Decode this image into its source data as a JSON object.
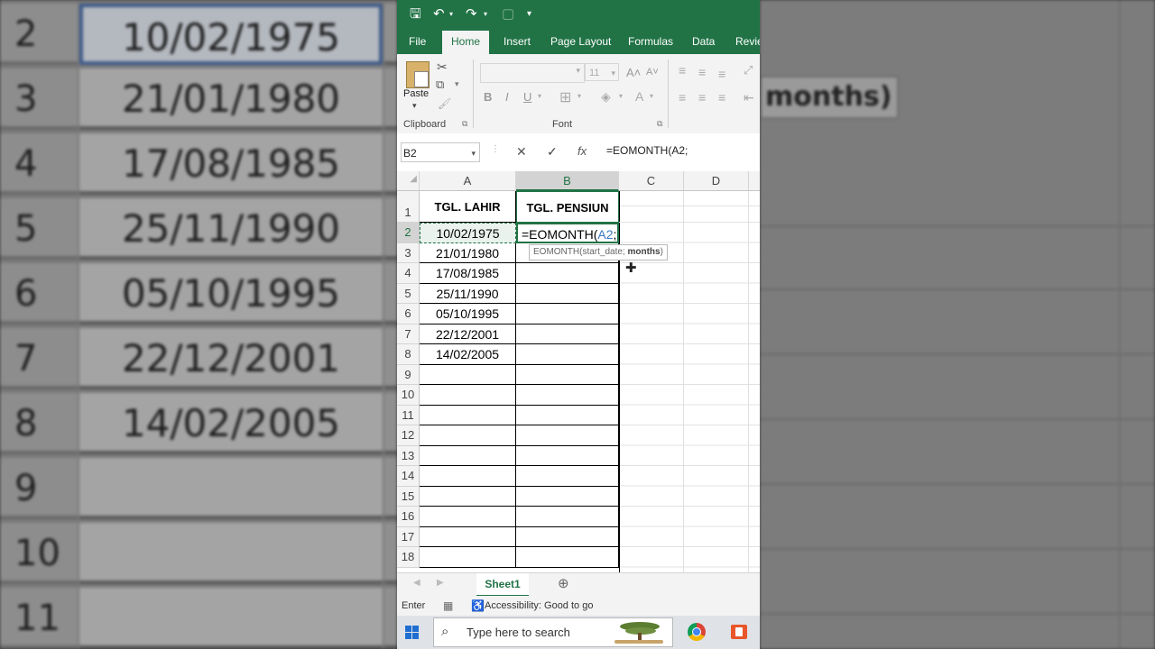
{
  "background": {
    "left_rows": [
      {
        "row": "2",
        "value": "10/02/1975"
      },
      {
        "row": "3",
        "value": "21/01/1980"
      },
      {
        "row": "4",
        "value": "17/08/1985"
      },
      {
        "row": "5",
        "value": "25/11/1990"
      },
      {
        "row": "6",
        "value": "05/10/1995"
      },
      {
        "row": "7",
        "value": "22/12/2001"
      },
      {
        "row": "8",
        "value": "14/02/2005"
      },
      {
        "row": "9",
        "value": ""
      },
      {
        "row": "10",
        "value": ""
      },
      {
        "row": "11",
        "value": ""
      }
    ],
    "right_tooltip": "months)"
  },
  "title_bar": {
    "save_icon": "save-icon",
    "undo_icon": "undo-icon",
    "redo_icon": "redo-icon"
  },
  "tabs": [
    {
      "label": "File"
    },
    {
      "label": "Home",
      "active": true
    },
    {
      "label": "Insert"
    },
    {
      "label": "Page Layout"
    },
    {
      "label": "Formulas"
    },
    {
      "label": "Data"
    },
    {
      "label": "Revie"
    }
  ],
  "ribbon": {
    "paste_label": "Paste",
    "clipboard_label": "Clipboard",
    "font_label": "Font",
    "font_size": "11",
    "bold": "B",
    "italic": "I",
    "underline": "U"
  },
  "formula_bar": {
    "name_box": "B2",
    "cancel": "✕",
    "enter": "✓",
    "fx": "fx",
    "formula": "=EOMONTH(A2;"
  },
  "columns": [
    "A",
    "B",
    "C",
    "D"
  ],
  "rows": [
    "1",
    "2",
    "3",
    "4",
    "5",
    "6",
    "7",
    "8",
    "9",
    "10",
    "11",
    "12",
    "13",
    "14",
    "15",
    "16",
    "17",
    "18"
  ],
  "table": {
    "header_a": "TGL. LAHIR",
    "header_b": "TGL. PENSIUN",
    "dates": [
      "10/02/1975",
      "21/01/1980",
      "17/08/1985",
      "25/11/1990",
      "05/10/1995",
      "22/12/2001",
      "14/02/2005"
    ],
    "editing_prefix": "=EOMONTH(",
    "editing_ref": "A2",
    "editing_suffix": ";"
  },
  "tooltip": {
    "prefix": "EOMONTH(start_date; ",
    "bold": "months",
    "suffix": ")"
  },
  "sheet_tab": "Sheet1",
  "status": {
    "mode": "Enter",
    "accessibility": "Accessibility: Good to go"
  },
  "taskbar": {
    "search_placeholder": "Type here to search"
  }
}
